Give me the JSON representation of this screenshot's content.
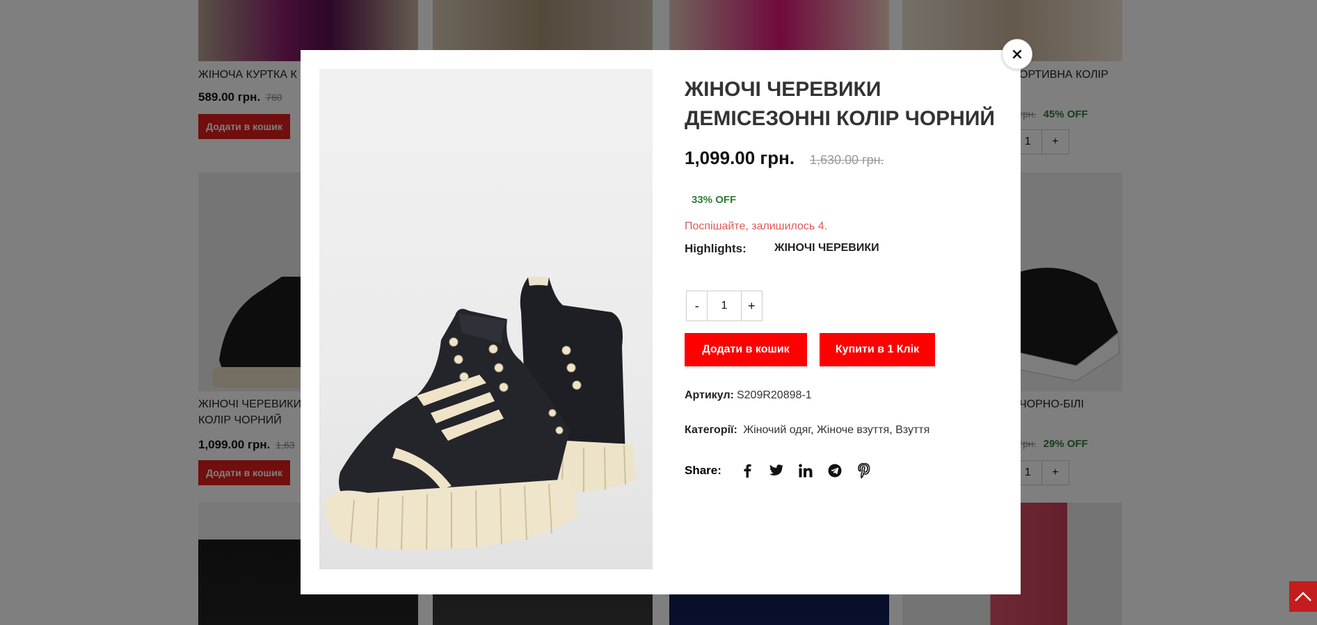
{
  "background_cards": [
    {
      "title": "ЖІНОЧА КУРТКА К",
      "price": "589.00 грн.",
      "old_price": "760",
      "cart_label": "Додати в кошик"
    },
    {
      "title": "ЖІНОЧІ ЧЕРЕВИКИ",
      "title_line2": "КОЛІР ЧОРНИЙ",
      "price": "1,099.00 грн.",
      "old_price": "1,63",
      "cart_label": "Додати в кошик"
    },
    {
      "title": "ОРТИВНА КОЛІР",
      "old_price": "грн.",
      "off": "45% OFF",
      "qty": "1",
      "minus": "-",
      "plus": "+"
    },
    {
      "title": "ЧОРНО-БІЛІ",
      "old_price": "грн.",
      "off": "29% OFF",
      "qty": "1",
      "minus": "-",
      "plus": "+"
    }
  ],
  "modal": {
    "close_icon": "close-icon",
    "product": {
      "title": "ЖІНОЧІ ЧЕРЕВИКИ ДЕМІСЕЗОННІ КОЛІР ЧОРНИЙ",
      "price": "1,099.00 грн.",
      "old_price": "1,630.00 грн.",
      "discount": "33% OFF",
      "stock_notice": "Поспішайте, залишилось 4.",
      "highlights_label": "Highlights:",
      "highlights_value": "ЖІНОЧІ ЧЕРЕВИКИ",
      "qty_minus": "-",
      "qty_value": "1",
      "qty_plus": "+",
      "add_to_cart_label": "Додати в кошик",
      "buy_one_click_label": "Купити в 1 Клік",
      "sku_label": "Артикул:",
      "sku_value": "S209R20898-1",
      "category_label": "Категорії:",
      "categories": [
        "Жіночий одяг",
        "Жіноче взуття",
        "Взуття"
      ],
      "category_separator": ",",
      "share_label": "Share:",
      "share_icons": [
        "facebook-icon",
        "twitter-icon",
        "linkedin-icon",
        "telegram-icon",
        "pinterest-icon"
      ]
    }
  },
  "colors": {
    "accent": "#ff0000",
    "discount": "#2e7d32",
    "stock": "#e05a5a",
    "scroll_top": "#c31d1d"
  }
}
